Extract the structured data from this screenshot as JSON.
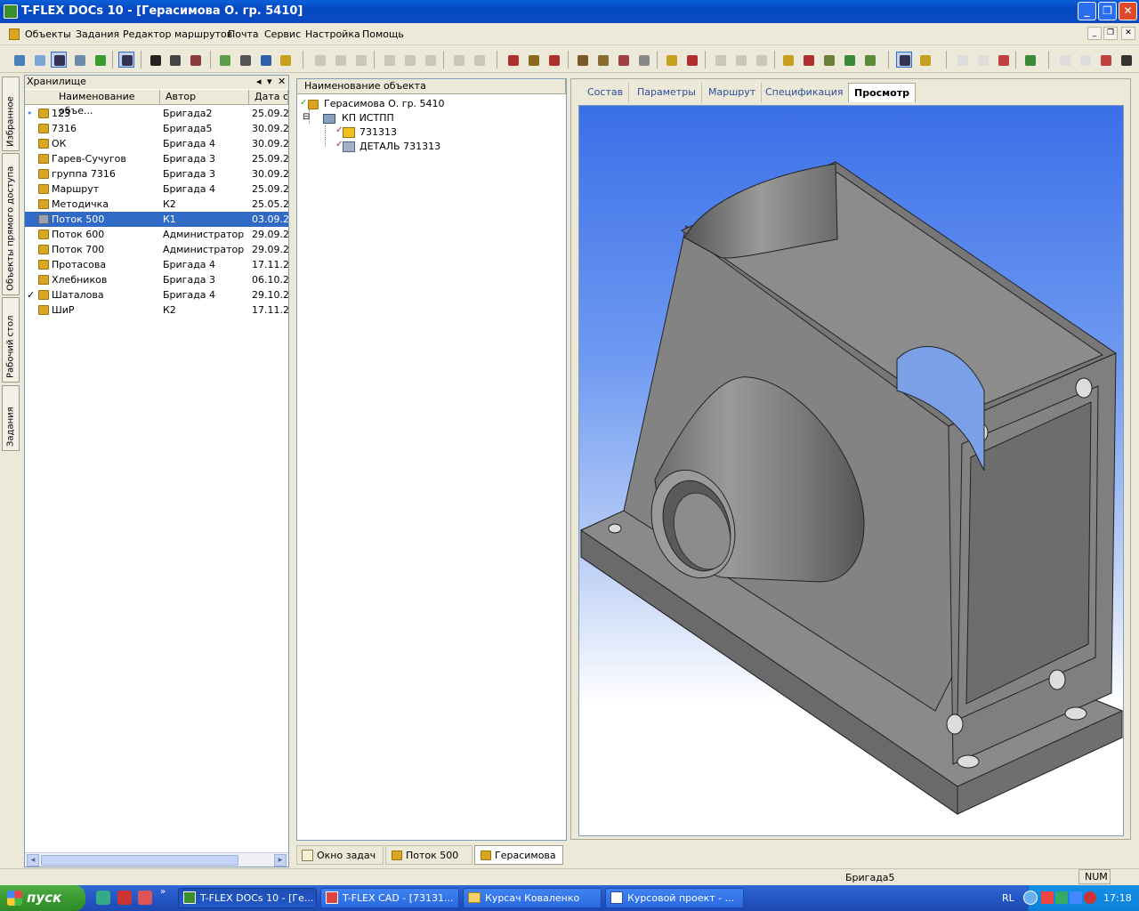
{
  "window": {
    "title": "T-FLEX DOCs 10 - [Герасимова  О. гр. 5410]",
    "buttons": [
      "_",
      "❐",
      "✕"
    ]
  },
  "menu": [
    "Объекты",
    "Задания",
    "Редактор маршрутов",
    "Почта",
    "Сервис",
    "Настройка",
    "Помощь"
  ],
  "sidetabs": [
    "Избранное",
    "Объекты прямого доступа",
    "Рабочий стол",
    "Задания"
  ],
  "left": {
    "title": "Хранилище",
    "header_icons": [
      "◂",
      "▾",
      "✕"
    ],
    "columns": [
      "Наименование объе...",
      "Автор",
      "Дата со"
    ],
    "rows": [
      {
        "name": "123",
        "author": "Бригада2",
        "date": "25.09.20",
        "mark": "•",
        "icon": "folder"
      },
      {
        "name": "7316",
        "author": "Бригада5",
        "date": "30.09.20",
        "mark": "",
        "icon": "folder"
      },
      {
        "name": "ОК",
        "author": "Бригада 4",
        "date": "30.09.20",
        "mark": "",
        "icon": "folder"
      },
      {
        "name": "Гарев-Сучугов",
        "author": "Бригада 3",
        "date": "25.09.20",
        "mark": "",
        "icon": "folder"
      },
      {
        "name": "группа 7316",
        "author": "Бригада 3",
        "date": "30.09.20",
        "mark": "",
        "icon": "folder"
      },
      {
        "name": "Маршрут",
        "author": "Бригада 4",
        "date": "25.09.20",
        "mark": "",
        "icon": "folder"
      },
      {
        "name": "Методичка",
        "author": "К2",
        "date": "25.05.20",
        "mark": "",
        "icon": "folder"
      },
      {
        "name": "Поток 500",
        "author": "К1",
        "date": "03.09.20",
        "mark": "",
        "icon": "gray",
        "selected": true
      },
      {
        "name": "Поток 600",
        "author": "Администратор",
        "date": "29.09.20",
        "mark": "",
        "icon": "folder"
      },
      {
        "name": "Поток 700",
        "author": "Администратор",
        "date": "29.09.20",
        "mark": "",
        "icon": "folder"
      },
      {
        "name": "Протасова",
        "author": "Бригада 4",
        "date": "17.11.20",
        "mark": "",
        "icon": "folder"
      },
      {
        "name": "Хлебников",
        "author": "Бригада 3",
        "date": "06.10.20",
        "mark": "",
        "icon": "folder"
      },
      {
        "name": "Шаталова",
        "author": "Бригада 4",
        "date": "29.10.20",
        "mark": "✓",
        "icon": "folder"
      },
      {
        "name": "ШиР",
        "author": "К2",
        "date": "17.11.20",
        "mark": "",
        "icon": "folder"
      }
    ]
  },
  "middle": {
    "column": "Наименование объекта",
    "tree": [
      {
        "label": "Герасимова  О. гр. 5410",
        "level": 0,
        "mark": "✓",
        "icon": "folder"
      },
      {
        "label": "КП ИСТПП",
        "level": 1,
        "mark": "⊟",
        "icon": "doc"
      },
      {
        "label": "731313",
        "level": 2,
        "mark": "✓",
        "icon": "3d"
      },
      {
        "label": "ДЕТАЛЬ 731313",
        "level": 2,
        "mark": "✓",
        "icon": "3d"
      }
    ]
  },
  "right": {
    "tabs": [
      "Состав",
      "Параметры",
      "Маршрут",
      "Спецификация",
      "Просмотр"
    ],
    "active_tab": "Просмотр"
  },
  "bottom_tabs": [
    {
      "label": "Окно задач",
      "active": false
    },
    {
      "label": "Поток 500",
      "active": false
    },
    {
      "label": "Герасимова ...",
      "active": true
    }
  ],
  "status": {
    "user": "Бригада5",
    "num": "NUM"
  },
  "taskbar": {
    "start": "пуск",
    "tasks": [
      "T-FLEX DOCs 10 - [Ге...",
      "T-FLEX CAD - [73131...",
      "Курсач Коваленко",
      "Курсовой проект - ..."
    ],
    "lang": "RL",
    "time": "17:18"
  }
}
